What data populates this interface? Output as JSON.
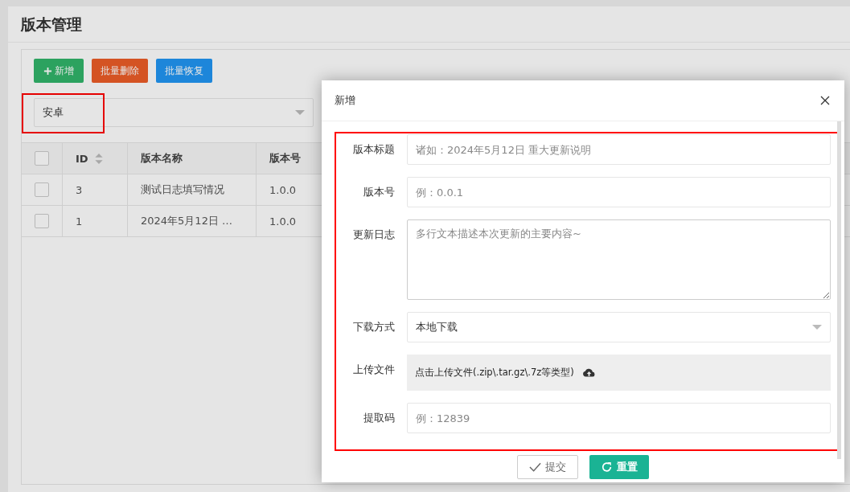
{
  "page": {
    "title": "版本管理"
  },
  "toolbar": [
    {
      "label": "新增",
      "kind": "add"
    },
    {
      "label": "批量删除",
      "kind": "danger"
    },
    {
      "label": "批量恢复",
      "kind": "info"
    }
  ],
  "filter": {
    "value": "安卓",
    "highlighted": true
  },
  "table": {
    "select_all": {
      "checked": false
    },
    "columns": [
      {
        "label": "ID",
        "sortable": true
      },
      {
        "label": "版本名称",
        "sortable": false
      },
      {
        "label": "版本号",
        "sortable": false
      }
    ],
    "rows": [
      {
        "checked": false,
        "cells": [
          "3",
          "测试日志填写情况",
          "1.0.0"
        ]
      },
      {
        "checked": false,
        "cells": [
          "1",
          "2024年5月12日 …",
          "1.0.0"
        ]
      }
    ]
  },
  "modal": {
    "title": "新增",
    "highlighted": true,
    "fields": [
      {
        "label": "版本标题",
        "kind": "input",
        "placeholder": "诸如：2024年5月12日 重大更新说明"
      },
      {
        "label": "版本号",
        "kind": "input",
        "placeholder": "例：0.0.1"
      },
      {
        "label": "更新日志",
        "kind": "textarea",
        "placeholder": "多行文本描述本次更新的主要内容~"
      },
      {
        "label": "下载方式",
        "kind": "select",
        "value": "本地下载"
      },
      {
        "label": "上传文件",
        "kind": "upload",
        "text": "点击上传文件(.zip\\.tar.gz\\.7z等类型)"
      },
      {
        "label": "提取码",
        "kind": "input",
        "placeholder": "例：12839"
      }
    ],
    "buttons": [
      {
        "label": "提交",
        "kind": "submit"
      },
      {
        "label": "重置",
        "kind": "reset"
      }
    ]
  }
}
